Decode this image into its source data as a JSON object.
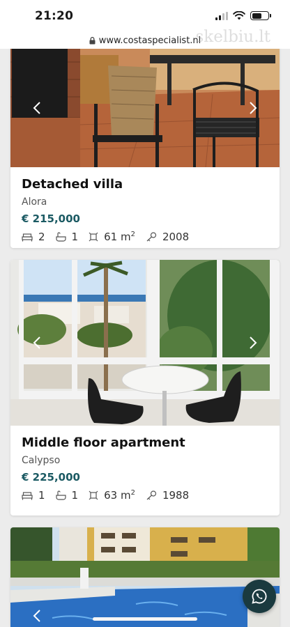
{
  "status_bar": {
    "time": "21:20"
  },
  "browser": {
    "url": "www.costaspecialist.nl"
  },
  "watermark": "skelbiu.lt",
  "listings": [
    {
      "title": "Detached villa",
      "location": "Alora",
      "price": "€ 215,000",
      "bedrooms": "2",
      "bathrooms": "1",
      "area": "61 m",
      "area_unit_sup": "2",
      "year": "2008"
    },
    {
      "title": "Middle floor apartment",
      "location": "Calypso",
      "price": "€ 225,000",
      "bedrooms": "1",
      "bathrooms": "1",
      "area": "63 m",
      "area_unit_sup": "2",
      "year": "1988"
    }
  ],
  "icons": {
    "bed": "bed-icon",
    "bath": "bath-icon",
    "area": "area-icon",
    "year": "key-icon",
    "whatsapp": "whatsapp-icon",
    "prev": "chevron-left-icon",
    "next": "chevron-right-icon",
    "lock": "lock-icon"
  },
  "colors": {
    "price": "#1b5a63",
    "whatsapp_bg": "#1a3a3f"
  }
}
